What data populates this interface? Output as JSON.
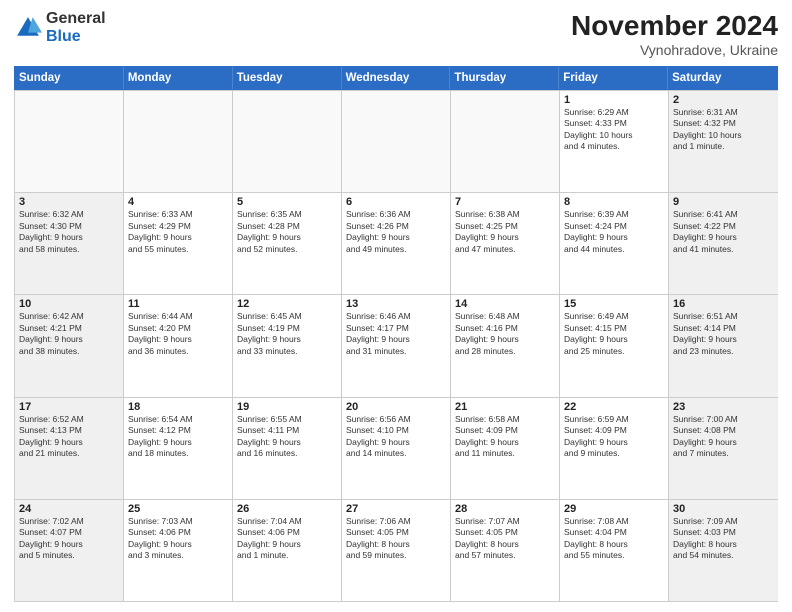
{
  "header": {
    "logo_general": "General",
    "logo_blue": "Blue",
    "month_year": "November 2024",
    "location": "Vynohradove, Ukraine"
  },
  "weekdays": [
    "Sunday",
    "Monday",
    "Tuesday",
    "Wednesday",
    "Thursday",
    "Friday",
    "Saturday"
  ],
  "rows": [
    [
      {
        "day": "",
        "info": ""
      },
      {
        "day": "",
        "info": ""
      },
      {
        "day": "",
        "info": ""
      },
      {
        "day": "",
        "info": ""
      },
      {
        "day": "",
        "info": ""
      },
      {
        "day": "1",
        "info": "Sunrise: 6:29 AM\nSunset: 4:33 PM\nDaylight: 10 hours\nand 4 minutes."
      },
      {
        "day": "2",
        "info": "Sunrise: 6:31 AM\nSunset: 4:32 PM\nDaylight: 10 hours\nand 1 minute."
      }
    ],
    [
      {
        "day": "3",
        "info": "Sunrise: 6:32 AM\nSunset: 4:30 PM\nDaylight: 9 hours\nand 58 minutes."
      },
      {
        "day": "4",
        "info": "Sunrise: 6:33 AM\nSunset: 4:29 PM\nDaylight: 9 hours\nand 55 minutes."
      },
      {
        "day": "5",
        "info": "Sunrise: 6:35 AM\nSunset: 4:28 PM\nDaylight: 9 hours\nand 52 minutes."
      },
      {
        "day": "6",
        "info": "Sunrise: 6:36 AM\nSunset: 4:26 PM\nDaylight: 9 hours\nand 49 minutes."
      },
      {
        "day": "7",
        "info": "Sunrise: 6:38 AM\nSunset: 4:25 PM\nDaylight: 9 hours\nand 47 minutes."
      },
      {
        "day": "8",
        "info": "Sunrise: 6:39 AM\nSunset: 4:24 PM\nDaylight: 9 hours\nand 44 minutes."
      },
      {
        "day": "9",
        "info": "Sunrise: 6:41 AM\nSunset: 4:22 PM\nDaylight: 9 hours\nand 41 minutes."
      }
    ],
    [
      {
        "day": "10",
        "info": "Sunrise: 6:42 AM\nSunset: 4:21 PM\nDaylight: 9 hours\nand 38 minutes."
      },
      {
        "day": "11",
        "info": "Sunrise: 6:44 AM\nSunset: 4:20 PM\nDaylight: 9 hours\nand 36 minutes."
      },
      {
        "day": "12",
        "info": "Sunrise: 6:45 AM\nSunset: 4:19 PM\nDaylight: 9 hours\nand 33 minutes."
      },
      {
        "day": "13",
        "info": "Sunrise: 6:46 AM\nSunset: 4:17 PM\nDaylight: 9 hours\nand 31 minutes."
      },
      {
        "day": "14",
        "info": "Sunrise: 6:48 AM\nSunset: 4:16 PM\nDaylight: 9 hours\nand 28 minutes."
      },
      {
        "day": "15",
        "info": "Sunrise: 6:49 AM\nSunset: 4:15 PM\nDaylight: 9 hours\nand 25 minutes."
      },
      {
        "day": "16",
        "info": "Sunrise: 6:51 AM\nSunset: 4:14 PM\nDaylight: 9 hours\nand 23 minutes."
      }
    ],
    [
      {
        "day": "17",
        "info": "Sunrise: 6:52 AM\nSunset: 4:13 PM\nDaylight: 9 hours\nand 21 minutes."
      },
      {
        "day": "18",
        "info": "Sunrise: 6:54 AM\nSunset: 4:12 PM\nDaylight: 9 hours\nand 18 minutes."
      },
      {
        "day": "19",
        "info": "Sunrise: 6:55 AM\nSunset: 4:11 PM\nDaylight: 9 hours\nand 16 minutes."
      },
      {
        "day": "20",
        "info": "Sunrise: 6:56 AM\nSunset: 4:10 PM\nDaylight: 9 hours\nand 14 minutes."
      },
      {
        "day": "21",
        "info": "Sunrise: 6:58 AM\nSunset: 4:09 PM\nDaylight: 9 hours\nand 11 minutes."
      },
      {
        "day": "22",
        "info": "Sunrise: 6:59 AM\nSunset: 4:09 PM\nDaylight: 9 hours\nand 9 minutes."
      },
      {
        "day": "23",
        "info": "Sunrise: 7:00 AM\nSunset: 4:08 PM\nDaylight: 9 hours\nand 7 minutes."
      }
    ],
    [
      {
        "day": "24",
        "info": "Sunrise: 7:02 AM\nSunset: 4:07 PM\nDaylight: 9 hours\nand 5 minutes."
      },
      {
        "day": "25",
        "info": "Sunrise: 7:03 AM\nSunset: 4:06 PM\nDaylight: 9 hours\nand 3 minutes."
      },
      {
        "day": "26",
        "info": "Sunrise: 7:04 AM\nSunset: 4:06 PM\nDaylight: 9 hours\nand 1 minute."
      },
      {
        "day": "27",
        "info": "Sunrise: 7:06 AM\nSunset: 4:05 PM\nDaylight: 8 hours\nand 59 minutes."
      },
      {
        "day": "28",
        "info": "Sunrise: 7:07 AM\nSunset: 4:05 PM\nDaylight: 8 hours\nand 57 minutes."
      },
      {
        "day": "29",
        "info": "Sunrise: 7:08 AM\nSunset: 4:04 PM\nDaylight: 8 hours\nand 55 minutes."
      },
      {
        "day": "30",
        "info": "Sunrise: 7:09 AM\nSunset: 4:03 PM\nDaylight: 8 hours\nand 54 minutes."
      }
    ]
  ]
}
